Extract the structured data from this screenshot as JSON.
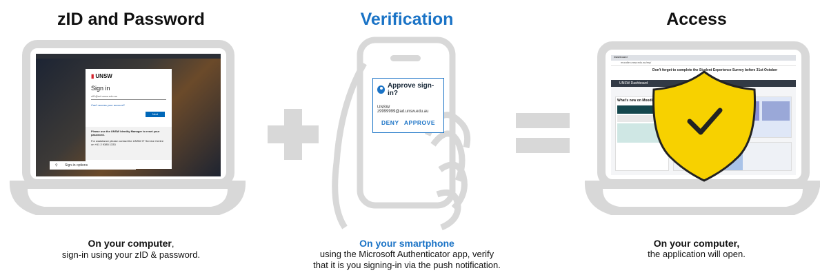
{
  "steps": [
    {
      "title": "zID and Password",
      "caption_strong": "On your computer",
      "caption_strong_suffix": ",",
      "caption_line2": "sign-in using your zID & password."
    },
    {
      "title": "Verification",
      "caption_strong": "On your smartphone",
      "caption_line2": "using the Microsoft Authenticator app, verify",
      "caption_line3": "that it is you signing-in via the push notification."
    },
    {
      "title": "Access",
      "caption_strong": "On your computer,",
      "caption_line2": "the application will open."
    }
  ],
  "signin_screen": {
    "logo": "UNSW",
    "heading": "Sign in",
    "field_placeholder": "zID@ad.unsw.edu.au",
    "link": "Can't access your account?",
    "next": "Next",
    "info_bold": "Please use the UNSW Identity Manager to reset your password.",
    "info_text": "For assistance please contact the UNSW IT Service Centre on +61 2 9385 1333",
    "options": "Sign-in options"
  },
  "notification": {
    "title": "Approve sign-in?",
    "org": "UNSW",
    "account": "z9999999@ad.unsw.edu.au",
    "deny": "DENY",
    "approve": "APPROVE"
  },
  "access_screen": {
    "tab": "Dashboard",
    "address": "moodle.unsw.edu.au/my/",
    "banner": "Don't forget to complete the Student Experience Survey before 31st October",
    "nav": "UNSW Dashboard",
    "card_title": "What's new on Moodle 3.9?"
  },
  "colors": {
    "accent_blue": "#1a73c6",
    "device_gray": "#d8d8d8",
    "shield_yellow": "#f7d100"
  }
}
